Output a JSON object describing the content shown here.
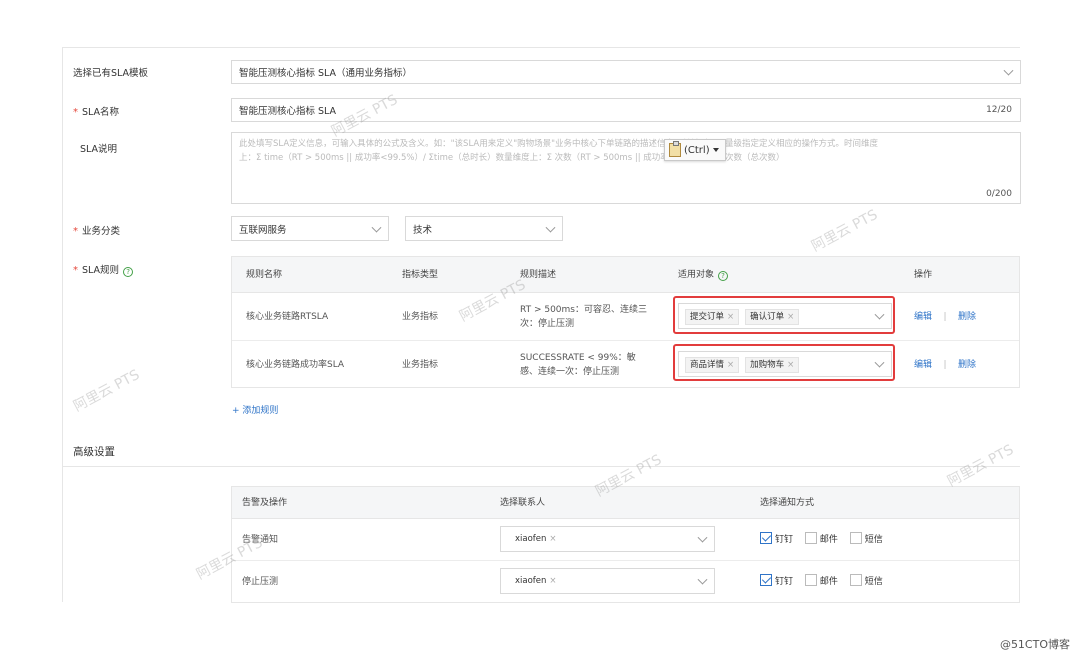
{
  "template": {
    "label": "选择已有SLA模板",
    "value": "智能压测核心指标 SLA（通用业务指标）"
  },
  "sla_name": {
    "required": "*",
    "label": "SLA名称",
    "value": "智能压测核心指标 SLA",
    "counter": "12/20"
  },
  "sla_desc": {
    "label": "SLA说明",
    "placeholder_line1": "此处填写SLA定义信息，可输入具体的公式及含义。如：\"该SLA用来定义\"购物场景\"业务中核心下单链路的描述信息，并针对不同量级指定定义相应的操作方式。时间维度",
    "placeholder_line2": "上：Σ time（RT > 500ms || 成功率<99.5%）/ Σtime（总时长）数量维度上：Σ 次数（RT > 500ms || 成功率<99.5%）/ Σ 次数（总次数）",
    "counter": "0/200"
  },
  "category": {
    "required": "*",
    "label": "业务分类",
    "select1": "互联网服务",
    "select2": "技术"
  },
  "rules": {
    "required": "*",
    "label": "SLA规则",
    "help": "?",
    "headers": {
      "name": "规则名称",
      "type": "指标类型",
      "desc": "规则描述",
      "target": "适用对象",
      "target_help": "?",
      "ops": "操作"
    },
    "rows": [
      {
        "name": "核心业务链路RTSLA",
        "type": "业务指标",
        "desc_line1": "RT > 500ms：可容忍、连续三",
        "desc_line2": "次：停止压测",
        "tags": [
          "提交订单",
          "确认订单"
        ],
        "edit": "编辑",
        "sep": "|",
        "delete": "删除"
      },
      {
        "name": "核心业务链路成功率SLA",
        "type": "业务指标",
        "desc_line1": "SUCCESSRATE < 99%：敏",
        "desc_line2": "感、连续一次：停止压测",
        "tags": [
          "商品详情",
          "加购物车"
        ],
        "edit": "编辑",
        "sep": "|",
        "delete": "删除"
      }
    ],
    "tag_close": "×",
    "add_rule": "+ 添加规则"
  },
  "advanced": {
    "title": "高级设置",
    "headers": {
      "alarm": "告警及操作",
      "contact": "选择联系人",
      "notify": "选择通知方式"
    },
    "rows": [
      {
        "alarm": "告警通知",
        "contact": "xiaofen",
        "channels": [
          {
            "label": "钉钉",
            "checked": true
          },
          {
            "label": "邮件",
            "checked": false
          },
          {
            "label": "短信",
            "checked": false
          }
        ]
      },
      {
        "alarm": "停止压测",
        "contact": "xiaofen",
        "channels": [
          {
            "label": "钉钉",
            "checked": true
          },
          {
            "label": "邮件",
            "checked": false
          },
          {
            "label": "短信",
            "checked": false
          }
        ]
      }
    ]
  },
  "paste_popup": {
    "label": "(Ctrl)"
  },
  "watermark": "阿里云 PTS",
  "footer": "@51CTO博客",
  "colors": {
    "highlight_border": "#e23c3c",
    "link": "#2f74c8",
    "required": "#e5483c",
    "help_icon": "#43a047"
  }
}
